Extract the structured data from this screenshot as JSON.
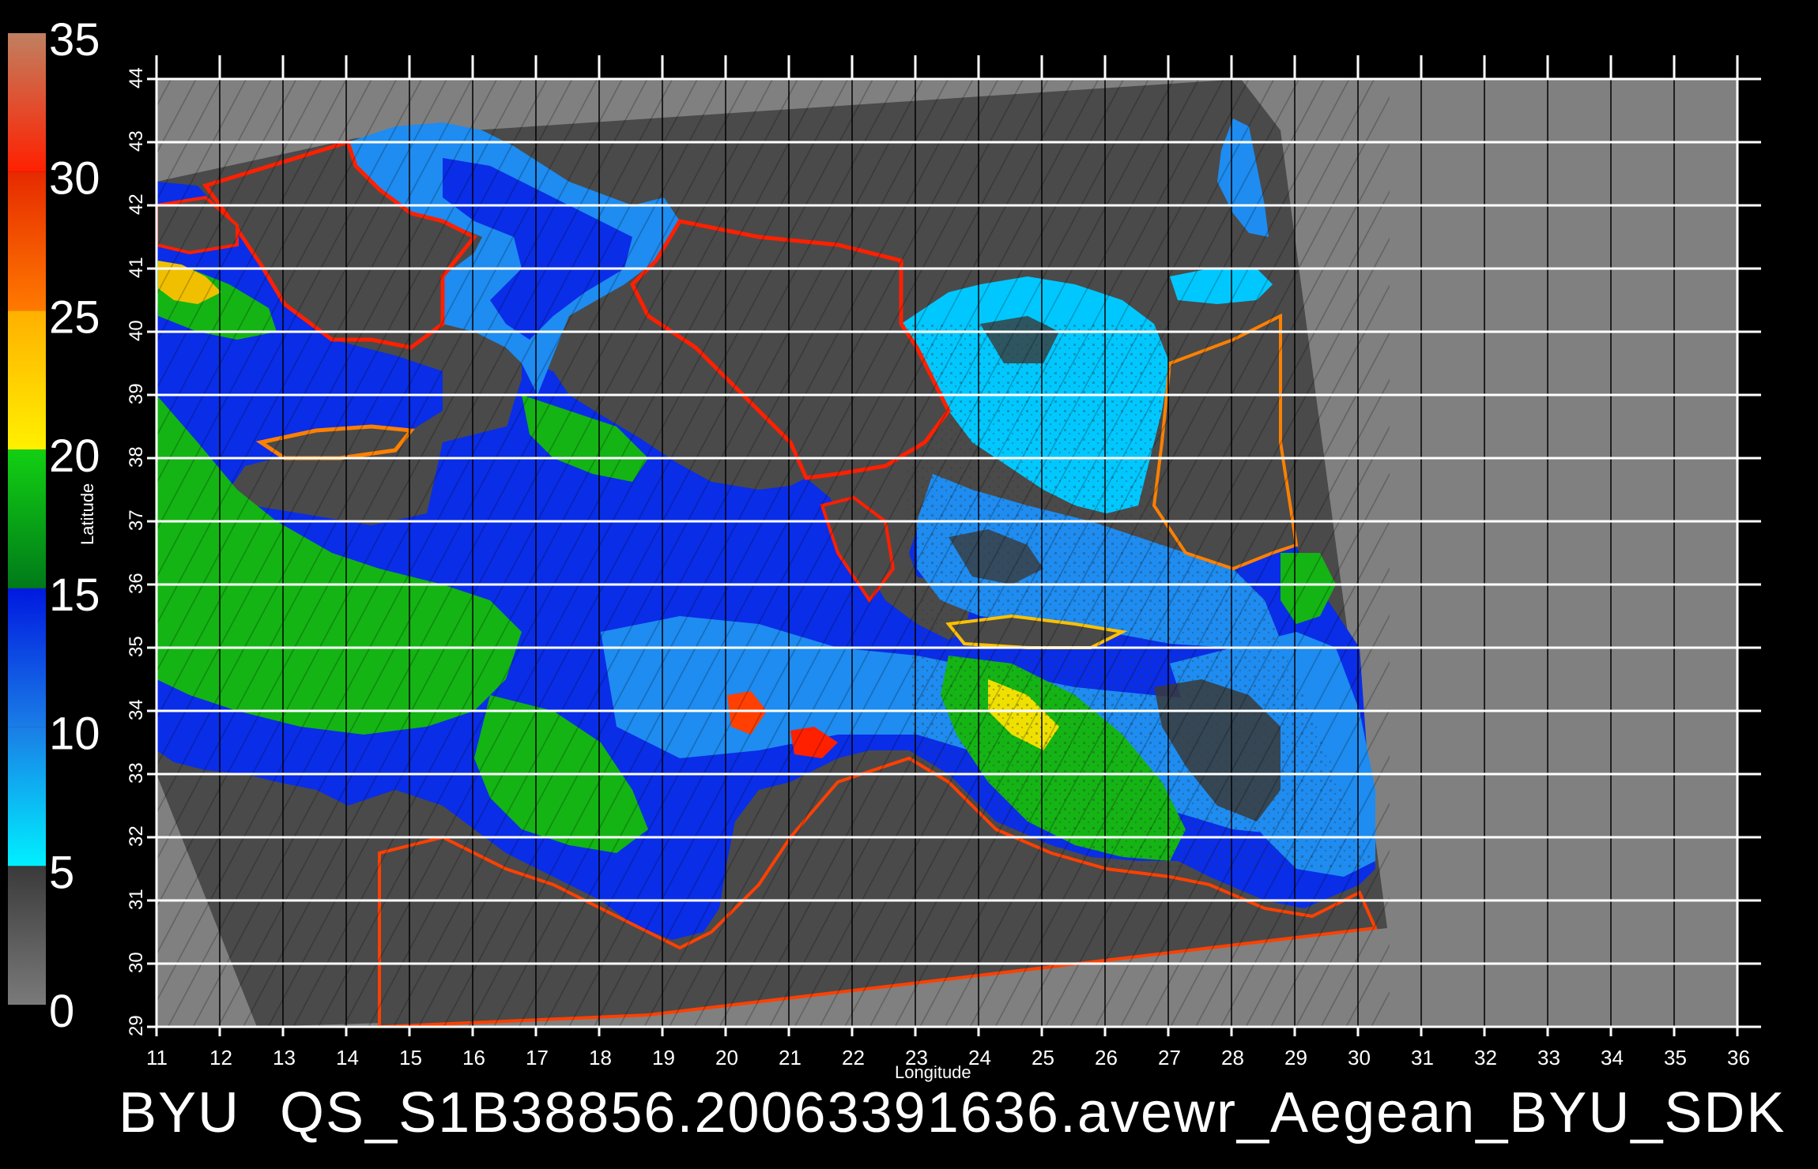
{
  "caption": {
    "source": "BYU",
    "filename": "QS_S1B38856.20063391636.avewr_Aegean_BYU_SDK"
  },
  "axes": {
    "x_title": "Longitude",
    "y_title": "Latitude",
    "x_ticks": [
      11,
      12,
      13,
      14,
      15,
      16,
      17,
      18,
      19,
      20,
      21,
      22,
      23,
      24,
      25,
      26,
      27,
      28,
      29,
      30,
      31,
      32,
      33,
      34,
      35,
      36
    ],
    "y_ticks": [
      29,
      30,
      31,
      32,
      33,
      34,
      35,
      36,
      37,
      38,
      39,
      40,
      41,
      42,
      43,
      44
    ],
    "xlim": [
      11,
      36
    ],
    "ylim": [
      29,
      44
    ]
  },
  "colorbar": {
    "tick_labels": [
      "0",
      "5",
      "10",
      "15",
      "20",
      "25",
      "30",
      "35"
    ],
    "range": [
      0,
      35
    ],
    "segments": [
      {
        "from": 0,
        "to": 5,
        "color": "#7a7a7a",
        "color2": "#3a3a3a"
      },
      {
        "from": 5,
        "to": 10,
        "color": "#00f0ff",
        "color2": "#1a7de6"
      },
      {
        "from": 10,
        "to": 15,
        "color": "#1a7de6",
        "color2": "#0019e0"
      },
      {
        "from": 15,
        "to": 20,
        "color": "#007a1a",
        "color2": "#12d012"
      },
      {
        "from": 20,
        "to": 25,
        "color": "#fff000",
        "color2": "#ffb000"
      },
      {
        "from": 25,
        "to": 30,
        "color": "#ff7a00",
        "color2": "#e62a00"
      },
      {
        "from": 30,
        "to": 35,
        "color": "#ff2000",
        "color2": "#c08060"
      }
    ]
  },
  "map_colors": {
    "background": "#000000",
    "no_data": "#808080",
    "land": "#4a4a4a",
    "low": "#3a3a3a",
    "cyan": "#00d8ff",
    "light_blue": "#1e8cf0",
    "blue": "#0a2de8",
    "green": "#14b414",
    "yellow": "#f0e000",
    "orange": "#ff8000",
    "red": "#ff2000",
    "magenta": "#ff30ff"
  }
}
